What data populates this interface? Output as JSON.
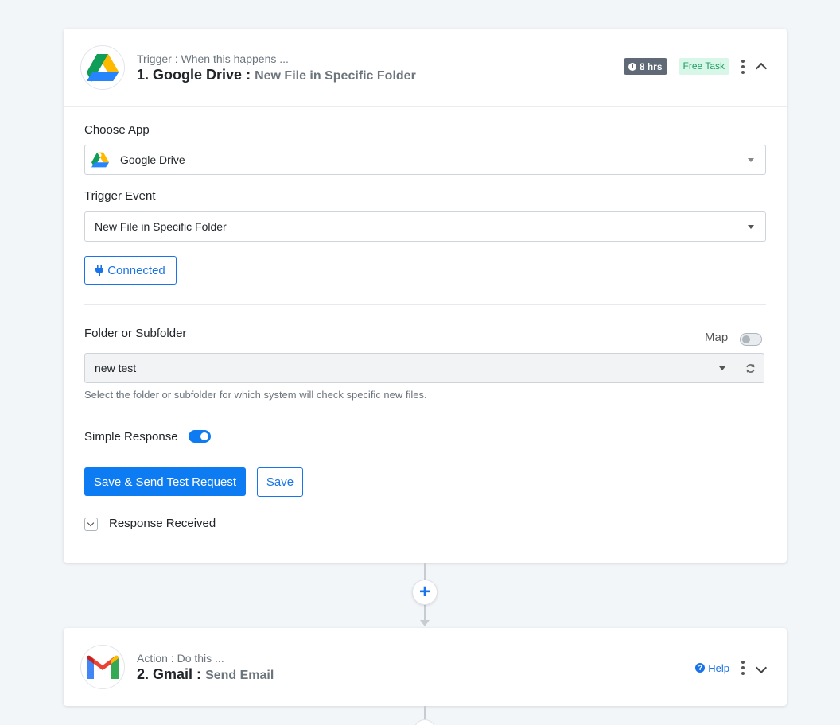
{
  "trigger_step": {
    "kicker": "Trigger : When this happens ...",
    "number_app": "1. Google Drive",
    "separator": ":",
    "event": "New File in Specific Folder",
    "time_badge": "8 hrs",
    "free_badge": "Free Task",
    "logo_icon": "google-drive-icon"
  },
  "form": {
    "choose_app_label": "Choose App",
    "choose_app_value": "Google Drive",
    "trigger_event_label": "Trigger Event",
    "trigger_event_value": "New File in Specific Folder",
    "connected_label": "Connected",
    "folder_label": "Folder or Subfolder",
    "map_label": "Map",
    "folder_value": "new test",
    "folder_help": "Select the folder or subfolder for which system will check specific new files.",
    "simple_response_label": "Simple Response",
    "simple_response_on": true,
    "map_on": false,
    "save_send_label": "Save & Send Test Request",
    "save_label": "Save",
    "response_received_label": "Response Received"
  },
  "connector": {
    "add_label": "+"
  },
  "action_step": {
    "kicker": "Action : Do this ...",
    "number_app": "2. Gmail",
    "separator": ":",
    "event": "Send Email",
    "help_label": "Help",
    "logo_icon": "gmail-icon"
  },
  "colors": {
    "primary": "#0d7bf2",
    "link": "#1a73e8",
    "free_badge_bg": "#d9f7e8",
    "free_badge_text": "#1f9d63",
    "time_badge_bg": "#5f6a76",
    "background": "#f3f6f9"
  }
}
